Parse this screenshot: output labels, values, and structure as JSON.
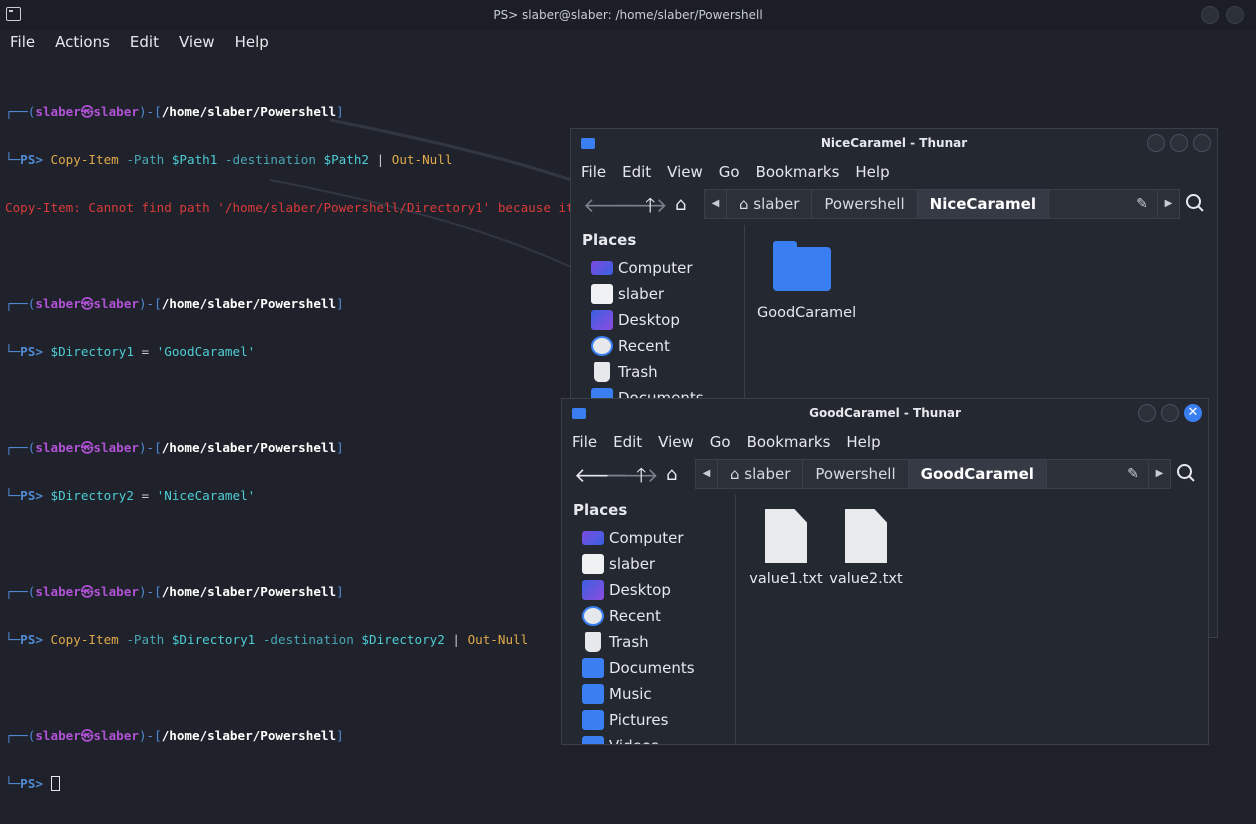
{
  "terminal": {
    "title": "PS> slaber@slaber: /home/slaber/Powershell",
    "menu": [
      "File",
      "Actions",
      "Edit",
      "View",
      "Help"
    ],
    "user": "slaber",
    "skull": "㉿",
    "path": "/home/slaber/Powershell",
    "prompt": "PS>",
    "cmd1": {
      "a": "Copy-Item",
      "b": " -Path ",
      "c": "$Path1",
      "d": " -destination ",
      "e": "$Path2",
      "f": " | ",
      "g": "Out-Null"
    },
    "error": "Copy-Item: Cannot find path '/home/slaber/Powershell/Directory1' because it does not exist.",
    "cmd2": {
      "var": "$Directory1",
      "eq": " = ",
      "val": "'GoodCaramel'"
    },
    "cmd3": {
      "var": "$Directory2",
      "eq": " = ",
      "val": "'NiceCaramel'"
    },
    "cmd4": {
      "a": "Copy-Item",
      "b": " -Path ",
      "c": "$Directory1",
      "d": " -destination ",
      "e": "$Directory2",
      "f": " | ",
      "g": "Out-Null"
    }
  },
  "thunar1": {
    "title": "NiceCaramel - Thunar",
    "menu": [
      "File",
      "Edit",
      "View",
      "Go",
      "Bookmarks",
      "Help"
    ],
    "path": [
      "slaber",
      "Powershell",
      "NiceCaramel"
    ],
    "places_header": "Places",
    "places": [
      "Computer",
      "slaber",
      "Desktop",
      "Recent",
      "Trash",
      "Documents"
    ],
    "files": [
      "GoodCaramel"
    ]
  },
  "thunar2": {
    "title": "GoodCaramel - Thunar",
    "menu": [
      "File",
      "Edit",
      "View",
      "Go",
      "Bookmarks",
      "Help"
    ],
    "path": [
      "slaber",
      "Powershell",
      "GoodCaramel"
    ],
    "places_header": "Places",
    "places": [
      "Computer",
      "slaber",
      "Desktop",
      "Recent",
      "Trash",
      "Documents",
      "Music",
      "Pictures",
      "Videos"
    ],
    "files": [
      "value1.txt",
      "value2.txt"
    ]
  },
  "colors": {
    "accent": "#3a7ff2",
    "error": "#d93a3a",
    "prompt_user": "#b052d6"
  },
  "icons": {
    "terminal": "terminal-icon",
    "folder": "folder-icon",
    "home": "home-icon",
    "back": "arrow-left-icon",
    "forward": "arrow-right-icon",
    "up": "arrow-up-icon",
    "edit": "pencil-icon",
    "search": "search-icon"
  }
}
